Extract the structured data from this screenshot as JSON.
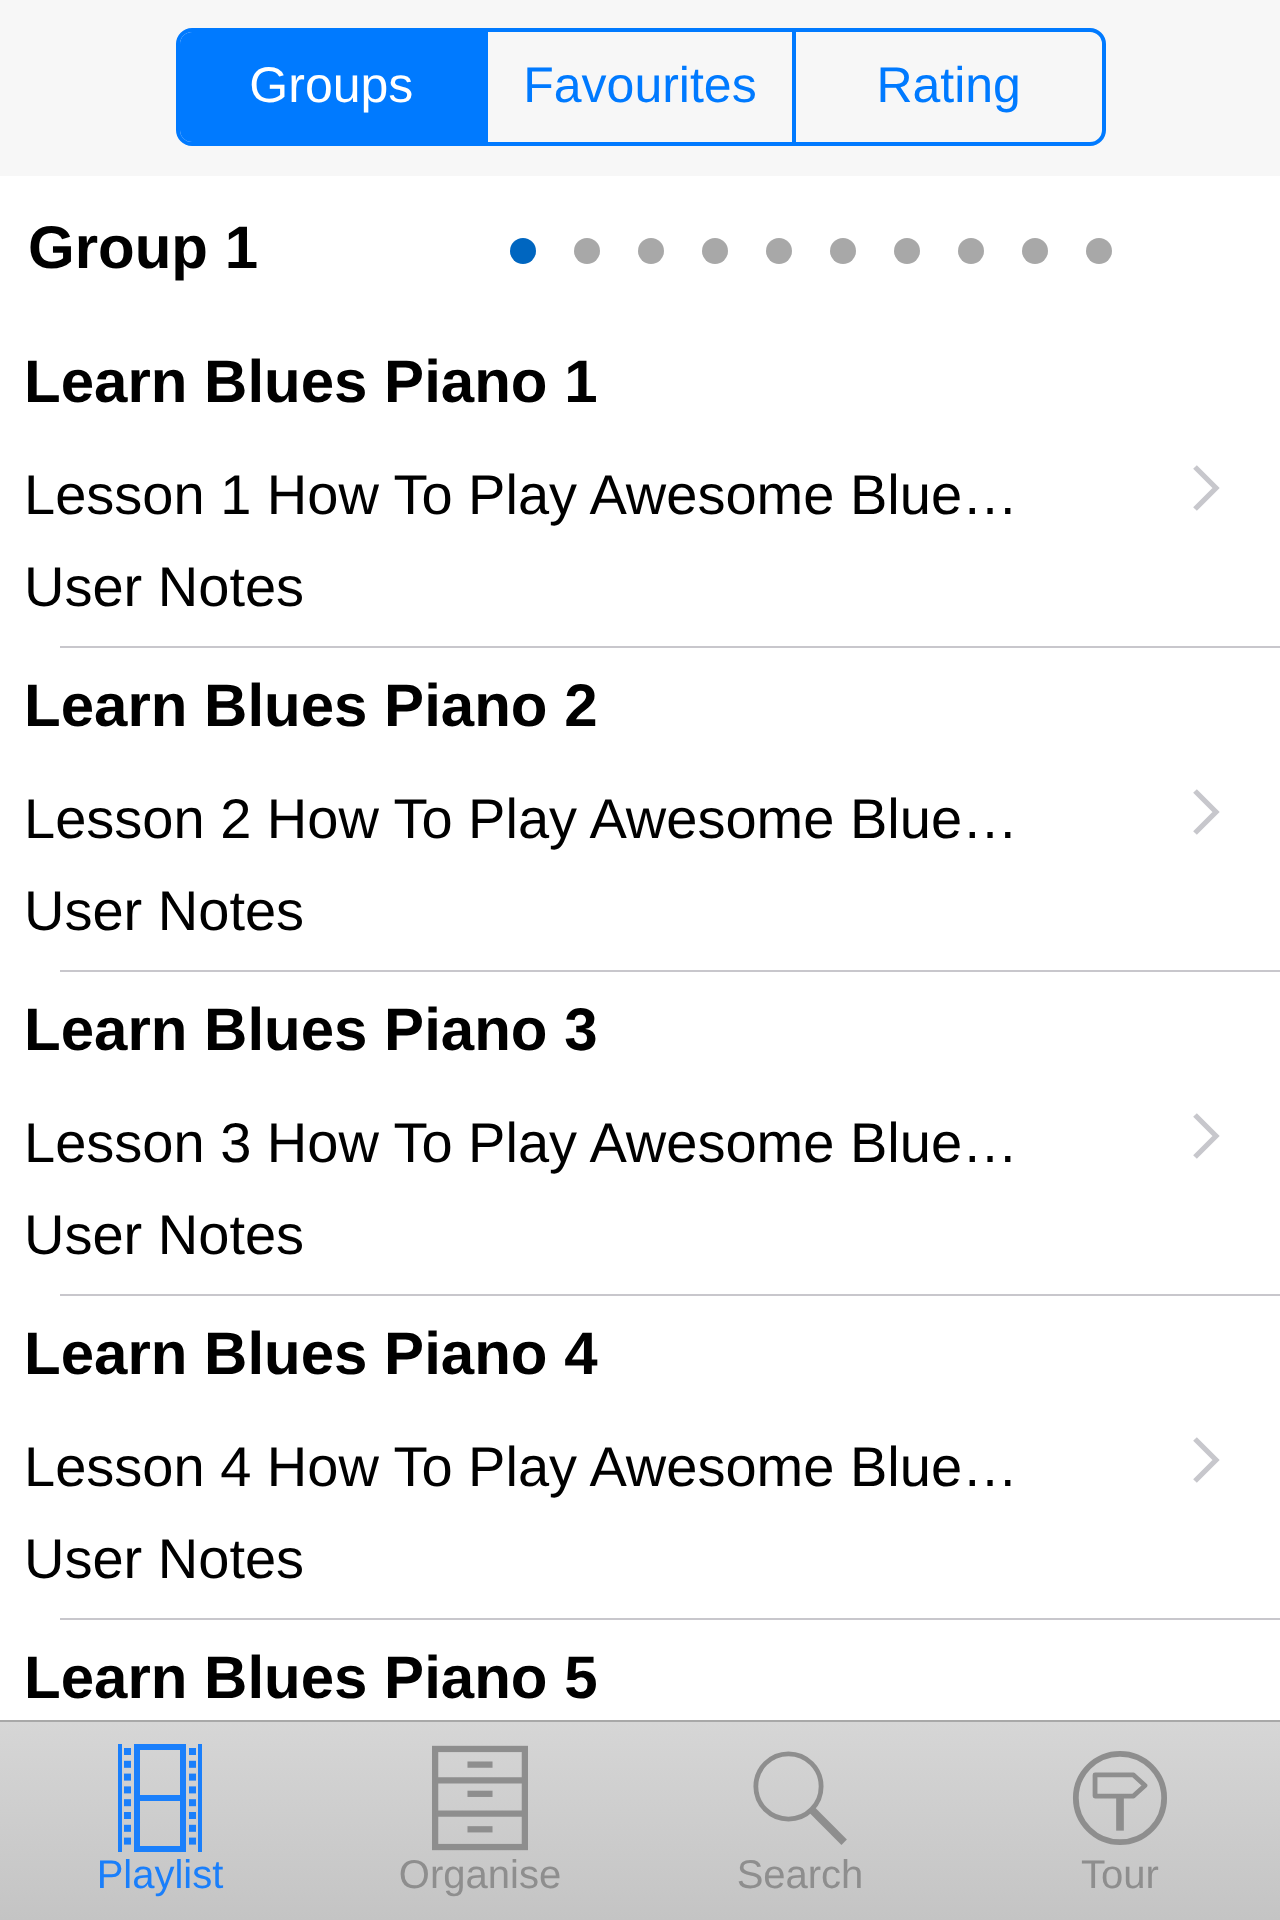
{
  "segmented_control": [
    {
      "label": "Groups",
      "selected": true
    },
    {
      "label": "Favourites",
      "selected": false
    },
    {
      "label": "Rating",
      "selected": false
    }
  ],
  "group_header": {
    "title": "Group 1",
    "page_dots": [
      {
        "selected": true
      },
      {
        "selected": false
      },
      {
        "selected": false
      },
      {
        "selected": false
      },
      {
        "selected": false
      },
      {
        "selected": false
      },
      {
        "selected": false
      },
      {
        "selected": false
      },
      {
        "selected": false
      },
      {
        "selected": false
      }
    ]
  },
  "lessons": [
    {
      "title": "Learn Blues Piano 1",
      "subtitle": "Lesson 1 How To Play Awesome Blue…",
      "notes": "User Notes"
    },
    {
      "title": "Learn Blues Piano 2",
      "subtitle": "Lesson 2 How To Play Awesome Blue…",
      "notes": "User Notes"
    },
    {
      "title": "Learn Blues Piano 3",
      "subtitle": "Lesson 3 How To Play Awesome Blue…",
      "notes": "User Notes"
    },
    {
      "title": "Learn Blues Piano 4",
      "subtitle": "Lesson 4 How To Play Awesome Blue…",
      "notes": "User Notes"
    },
    {
      "title": "Learn Blues Piano 5"
    }
  ],
  "tab_bar": [
    {
      "label": "Playlist",
      "kind": "film",
      "selected": true
    },
    {
      "label": "Organise",
      "kind": "cabinet",
      "selected": false
    },
    {
      "label": "Search",
      "kind": "search",
      "selected": false
    },
    {
      "label": "Tour",
      "kind": "signpost",
      "selected": false
    }
  ]
}
